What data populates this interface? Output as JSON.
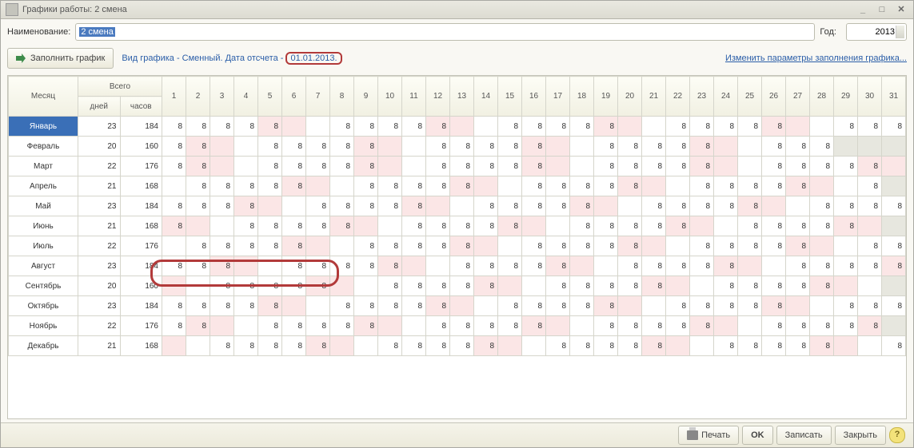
{
  "window": {
    "title": "Графики работы: 2 смена"
  },
  "form": {
    "name_label": "Наименование:",
    "name_value": "2 смена",
    "year_label": "Год:",
    "year_value": "2013"
  },
  "toolbar": {
    "fill_label": "Заполнить график",
    "info_prefix": "Вид графика - Сменный. Дата отсчета - ",
    "start_date": "01.01.2013.",
    "change_params": "Изменить параметры заполнения графика..."
  },
  "footer": {
    "print": "Печать",
    "ok": "OK",
    "save": "Записать",
    "close": "Закрыть"
  },
  "headers": {
    "month": "Месяц",
    "total": "Всего",
    "days": "дней",
    "hours": "часов"
  },
  "day_numbers": [
    1,
    2,
    3,
    4,
    5,
    6,
    7,
    8,
    9,
    10,
    11,
    12,
    13,
    14,
    15,
    16,
    17,
    18,
    19,
    20,
    21,
    22,
    23,
    24,
    25,
    26,
    27,
    28,
    29,
    30,
    31
  ],
  "rows": [
    {
      "month": "Январь",
      "current": true,
      "days": 23,
      "hours": 184,
      "cells": [
        {
          "v": 8
        },
        {
          "v": 8
        },
        {
          "v": 8
        },
        {
          "v": 8
        },
        {
          "v": 8,
          "p": 1
        },
        {
          "v": "",
          "p": 1
        },
        {
          "v": ""
        },
        {
          "v": 8
        },
        {
          "v": 8
        },
        {
          "v": 8
        },
        {
          "v": 8
        },
        {
          "v": 8,
          "p": 1
        },
        {
          "v": "",
          "p": 1
        },
        {
          "v": ""
        },
        {
          "v": 8
        },
        {
          "v": 8
        },
        {
          "v": 8
        },
        {
          "v": 8
        },
        {
          "v": 8,
          "p": 1
        },
        {
          "v": "",
          "p": 1
        },
        {
          "v": ""
        },
        {
          "v": 8
        },
        {
          "v": 8
        },
        {
          "v": 8
        },
        {
          "v": 8
        },
        {
          "v": 8,
          "p": 1
        },
        {
          "v": "",
          "p": 1
        },
        {
          "v": ""
        },
        {
          "v": 8
        },
        {
          "v": 8
        },
        {
          "v": 8
        }
      ]
    },
    {
      "month": "Февраль",
      "days": 20,
      "hours": 160,
      "cells": [
        {
          "v": 8
        },
        {
          "v": 8,
          "p": 1
        },
        {
          "v": "",
          "p": 1
        },
        {
          "v": ""
        },
        {
          "v": 8
        },
        {
          "v": 8
        },
        {
          "v": 8
        },
        {
          "v": 8
        },
        {
          "v": 8,
          "p": 1
        },
        {
          "v": "",
          "p": 1
        },
        {
          "v": ""
        },
        {
          "v": 8
        },
        {
          "v": 8
        },
        {
          "v": 8
        },
        {
          "v": 8
        },
        {
          "v": 8,
          "p": 1
        },
        {
          "v": "",
          "p": 1
        },
        {
          "v": ""
        },
        {
          "v": 8
        },
        {
          "v": 8
        },
        {
          "v": 8
        },
        {
          "v": 8
        },
        {
          "v": 8,
          "p": 1
        },
        {
          "v": "",
          "p": 1
        },
        {
          "v": ""
        },
        {
          "v": 8
        },
        {
          "v": 8
        },
        {
          "v": 8
        },
        {
          "v": "",
          "g": 1
        },
        {
          "v": "",
          "g": 1
        },
        {
          "v": "",
          "g": 1
        }
      ]
    },
    {
      "month": "Март",
      "days": 22,
      "hours": 176,
      "cells": [
        {
          "v": 8
        },
        {
          "v": 8,
          "p": 1
        },
        {
          "v": "",
          "p": 1
        },
        {
          "v": ""
        },
        {
          "v": 8
        },
        {
          "v": 8
        },
        {
          "v": 8
        },
        {
          "v": 8
        },
        {
          "v": 8,
          "p": 1
        },
        {
          "v": "",
          "p": 1
        },
        {
          "v": ""
        },
        {
          "v": 8
        },
        {
          "v": 8
        },
        {
          "v": 8
        },
        {
          "v": 8
        },
        {
          "v": 8,
          "p": 1
        },
        {
          "v": "",
          "p": 1
        },
        {
          "v": ""
        },
        {
          "v": 8
        },
        {
          "v": 8
        },
        {
          "v": 8
        },
        {
          "v": 8
        },
        {
          "v": 8,
          "p": 1
        },
        {
          "v": "",
          "p": 1
        },
        {
          "v": ""
        },
        {
          "v": 8
        },
        {
          "v": 8
        },
        {
          "v": 8
        },
        {
          "v": 8
        },
        {
          "v": 8,
          "p": 1
        },
        {
          "v": "",
          "p": 1
        }
      ]
    },
    {
      "month": "Апрель",
      "days": 21,
      "hours": 168,
      "cells": [
        {
          "v": ""
        },
        {
          "v": 8
        },
        {
          "v": 8
        },
        {
          "v": 8
        },
        {
          "v": 8
        },
        {
          "v": 8,
          "p": 1
        },
        {
          "v": "",
          "p": 1
        },
        {
          "v": ""
        },
        {
          "v": 8
        },
        {
          "v": 8
        },
        {
          "v": 8
        },
        {
          "v": 8
        },
        {
          "v": 8,
          "p": 1
        },
        {
          "v": "",
          "p": 1
        },
        {
          "v": ""
        },
        {
          "v": 8
        },
        {
          "v": 8
        },
        {
          "v": 8
        },
        {
          "v": 8
        },
        {
          "v": 8,
          "p": 1
        },
        {
          "v": "",
          "p": 1
        },
        {
          "v": ""
        },
        {
          "v": 8
        },
        {
          "v": 8
        },
        {
          "v": 8
        },
        {
          "v": 8
        },
        {
          "v": 8,
          "p": 1
        },
        {
          "v": "",
          "p": 1
        },
        {
          "v": ""
        },
        {
          "v": 8
        },
        {
          "v": "",
          "g": 1
        }
      ]
    },
    {
      "month": "Май",
      "days": 23,
      "hours": 184,
      "cells": [
        {
          "v": 8
        },
        {
          "v": 8
        },
        {
          "v": 8
        },
        {
          "v": 8,
          "p": 1
        },
        {
          "v": "",
          "p": 1
        },
        {
          "v": ""
        },
        {
          "v": 8
        },
        {
          "v": 8
        },
        {
          "v": 8
        },
        {
          "v": 8
        },
        {
          "v": 8,
          "p": 1
        },
        {
          "v": "",
          "p": 1
        },
        {
          "v": ""
        },
        {
          "v": 8
        },
        {
          "v": 8
        },
        {
          "v": 8
        },
        {
          "v": 8
        },
        {
          "v": 8,
          "p": 1
        },
        {
          "v": "",
          "p": 1
        },
        {
          "v": ""
        },
        {
          "v": 8
        },
        {
          "v": 8
        },
        {
          "v": 8
        },
        {
          "v": 8
        },
        {
          "v": 8,
          "p": 1
        },
        {
          "v": "",
          "p": 1
        },
        {
          "v": ""
        },
        {
          "v": 8
        },
        {
          "v": 8
        },
        {
          "v": 8
        },
        {
          "v": 8
        }
      ]
    },
    {
      "month": "Июнь",
      "days": 21,
      "hours": 168,
      "cells": [
        {
          "v": 8,
          "p": 1
        },
        {
          "v": "",
          "p": 1
        },
        {
          "v": ""
        },
        {
          "v": 8
        },
        {
          "v": 8
        },
        {
          "v": 8
        },
        {
          "v": 8
        },
        {
          "v": 8,
          "p": 1
        },
        {
          "v": "",
          "p": 1
        },
        {
          "v": ""
        },
        {
          "v": 8
        },
        {
          "v": 8
        },
        {
          "v": 8
        },
        {
          "v": 8
        },
        {
          "v": 8,
          "p": 1
        },
        {
          "v": "",
          "p": 1
        },
        {
          "v": ""
        },
        {
          "v": 8
        },
        {
          "v": 8
        },
        {
          "v": 8
        },
        {
          "v": 8
        },
        {
          "v": 8,
          "p": 1
        },
        {
          "v": "",
          "p": 1
        },
        {
          "v": ""
        },
        {
          "v": 8
        },
        {
          "v": 8
        },
        {
          "v": 8
        },
        {
          "v": 8
        },
        {
          "v": 8,
          "p": 1
        },
        {
          "v": "",
          "p": 1
        },
        {
          "v": "",
          "g": 1
        }
      ]
    },
    {
      "month": "Июль",
      "days": 22,
      "hours": 176,
      "cells": [
        {
          "v": ""
        },
        {
          "v": 8
        },
        {
          "v": 8
        },
        {
          "v": 8
        },
        {
          "v": 8
        },
        {
          "v": 8,
          "p": 1
        },
        {
          "v": "",
          "p": 1
        },
        {
          "v": ""
        },
        {
          "v": 8
        },
        {
          "v": 8
        },
        {
          "v": 8
        },
        {
          "v": 8
        },
        {
          "v": 8,
          "p": 1
        },
        {
          "v": "",
          "p": 1
        },
        {
          "v": ""
        },
        {
          "v": 8
        },
        {
          "v": 8
        },
        {
          "v": 8
        },
        {
          "v": 8
        },
        {
          "v": 8,
          "p": 1
        },
        {
          "v": "",
          "p": 1
        },
        {
          "v": ""
        },
        {
          "v": 8
        },
        {
          "v": 8
        },
        {
          "v": 8
        },
        {
          "v": 8
        },
        {
          "v": 8,
          "p": 1
        },
        {
          "v": "",
          "p": 1
        },
        {
          "v": ""
        },
        {
          "v": 8
        },
        {
          "v": 8
        }
      ]
    },
    {
      "month": "Август",
      "days": 23,
      "hours": 184,
      "cells": [
        {
          "v": 8
        },
        {
          "v": 8
        },
        {
          "v": 8,
          "p": 1
        },
        {
          "v": "",
          "p": 1
        },
        {
          "v": ""
        },
        {
          "v": 8
        },
        {
          "v": 8
        },
        {
          "v": 8
        },
        {
          "v": 8
        },
        {
          "v": 8,
          "p": 1
        },
        {
          "v": "",
          "p": 1
        },
        {
          "v": ""
        },
        {
          "v": 8
        },
        {
          "v": 8
        },
        {
          "v": 8
        },
        {
          "v": 8
        },
        {
          "v": 8,
          "p": 1
        },
        {
          "v": "",
          "p": 1
        },
        {
          "v": ""
        },
        {
          "v": 8
        },
        {
          "v": 8
        },
        {
          "v": 8
        },
        {
          "v": 8
        },
        {
          "v": 8,
          "p": 1
        },
        {
          "v": "",
          "p": 1
        },
        {
          "v": ""
        },
        {
          "v": 8
        },
        {
          "v": 8
        },
        {
          "v": 8
        },
        {
          "v": 8
        },
        {
          "v": 8,
          "p": 1
        }
      ]
    },
    {
      "month": "Сентябрь",
      "days": 20,
      "hours": 160,
      "cells": [
        {
          "v": "",
          "p": 1
        },
        {
          "v": ""
        },
        {
          "v": 8
        },
        {
          "v": 8
        },
        {
          "v": 8
        },
        {
          "v": 8
        },
        {
          "v": 8,
          "p": 1
        },
        {
          "v": "",
          "p": 1
        },
        {
          "v": ""
        },
        {
          "v": 8
        },
        {
          "v": 8
        },
        {
          "v": 8
        },
        {
          "v": 8
        },
        {
          "v": 8,
          "p": 1
        },
        {
          "v": "",
          "p": 1
        },
        {
          "v": ""
        },
        {
          "v": 8
        },
        {
          "v": 8
        },
        {
          "v": 8
        },
        {
          "v": 8
        },
        {
          "v": 8,
          "p": 1
        },
        {
          "v": "",
          "p": 1
        },
        {
          "v": ""
        },
        {
          "v": 8
        },
        {
          "v": 8
        },
        {
          "v": 8
        },
        {
          "v": 8
        },
        {
          "v": 8,
          "p": 1
        },
        {
          "v": "",
          "p": 1
        },
        {
          "v": ""
        },
        {
          "v": "",
          "g": 1
        }
      ]
    },
    {
      "month": "Октябрь",
      "days": 23,
      "hours": 184,
      "cells": [
        {
          "v": 8
        },
        {
          "v": 8
        },
        {
          "v": 8
        },
        {
          "v": 8
        },
        {
          "v": 8,
          "p": 1
        },
        {
          "v": "",
          "p": 1
        },
        {
          "v": ""
        },
        {
          "v": 8
        },
        {
          "v": 8
        },
        {
          "v": 8
        },
        {
          "v": 8
        },
        {
          "v": 8,
          "p": 1
        },
        {
          "v": "",
          "p": 1
        },
        {
          "v": ""
        },
        {
          "v": 8
        },
        {
          "v": 8
        },
        {
          "v": 8
        },
        {
          "v": 8
        },
        {
          "v": 8,
          "p": 1
        },
        {
          "v": "",
          "p": 1
        },
        {
          "v": ""
        },
        {
          "v": 8
        },
        {
          "v": 8
        },
        {
          "v": 8
        },
        {
          "v": 8
        },
        {
          "v": 8,
          "p": 1
        },
        {
          "v": "",
          "p": 1
        },
        {
          "v": ""
        },
        {
          "v": 8
        },
        {
          "v": 8
        },
        {
          "v": 8
        }
      ]
    },
    {
      "month": "Ноябрь",
      "days": 22,
      "hours": 176,
      "cells": [
        {
          "v": 8
        },
        {
          "v": 8,
          "p": 1
        },
        {
          "v": "",
          "p": 1
        },
        {
          "v": ""
        },
        {
          "v": 8
        },
        {
          "v": 8
        },
        {
          "v": 8
        },
        {
          "v": 8
        },
        {
          "v": 8,
          "p": 1
        },
        {
          "v": "",
          "p": 1
        },
        {
          "v": ""
        },
        {
          "v": 8
        },
        {
          "v": 8
        },
        {
          "v": 8
        },
        {
          "v": 8
        },
        {
          "v": 8,
          "p": 1
        },
        {
          "v": "",
          "p": 1
        },
        {
          "v": ""
        },
        {
          "v": 8
        },
        {
          "v": 8
        },
        {
          "v": 8
        },
        {
          "v": 8
        },
        {
          "v": 8,
          "p": 1
        },
        {
          "v": "",
          "p": 1
        },
        {
          "v": ""
        },
        {
          "v": 8
        },
        {
          "v": 8
        },
        {
          "v": 8
        },
        {
          "v": 8
        },
        {
          "v": 8,
          "p": 1
        },
        {
          "v": "",
          "g": 1
        }
      ]
    },
    {
      "month": "Декабрь",
      "days": 21,
      "hours": 168,
      "cells": [
        {
          "v": "",
          "p": 1
        },
        {
          "v": ""
        },
        {
          "v": 8
        },
        {
          "v": 8
        },
        {
          "v": 8
        },
        {
          "v": 8
        },
        {
          "v": 8,
          "p": 1
        },
        {
          "v": "",
          "p": 1
        },
        {
          "v": ""
        },
        {
          "v": 8
        },
        {
          "v": 8
        },
        {
          "v": 8
        },
        {
          "v": 8
        },
        {
          "v": 8,
          "p": 1
        },
        {
          "v": "",
          "p": 1
        },
        {
          "v": ""
        },
        {
          "v": 8
        },
        {
          "v": 8
        },
        {
          "v": 8
        },
        {
          "v": 8
        },
        {
          "v": 8,
          "p": 1
        },
        {
          "v": "",
          "p": 1
        },
        {
          "v": ""
        },
        {
          "v": 8
        },
        {
          "v": 8
        },
        {
          "v": 8
        },
        {
          "v": 8
        },
        {
          "v": 8,
          "p": 1
        },
        {
          "v": "",
          "p": 1
        },
        {
          "v": ""
        },
        {
          "v": 8
        }
      ]
    }
  ]
}
